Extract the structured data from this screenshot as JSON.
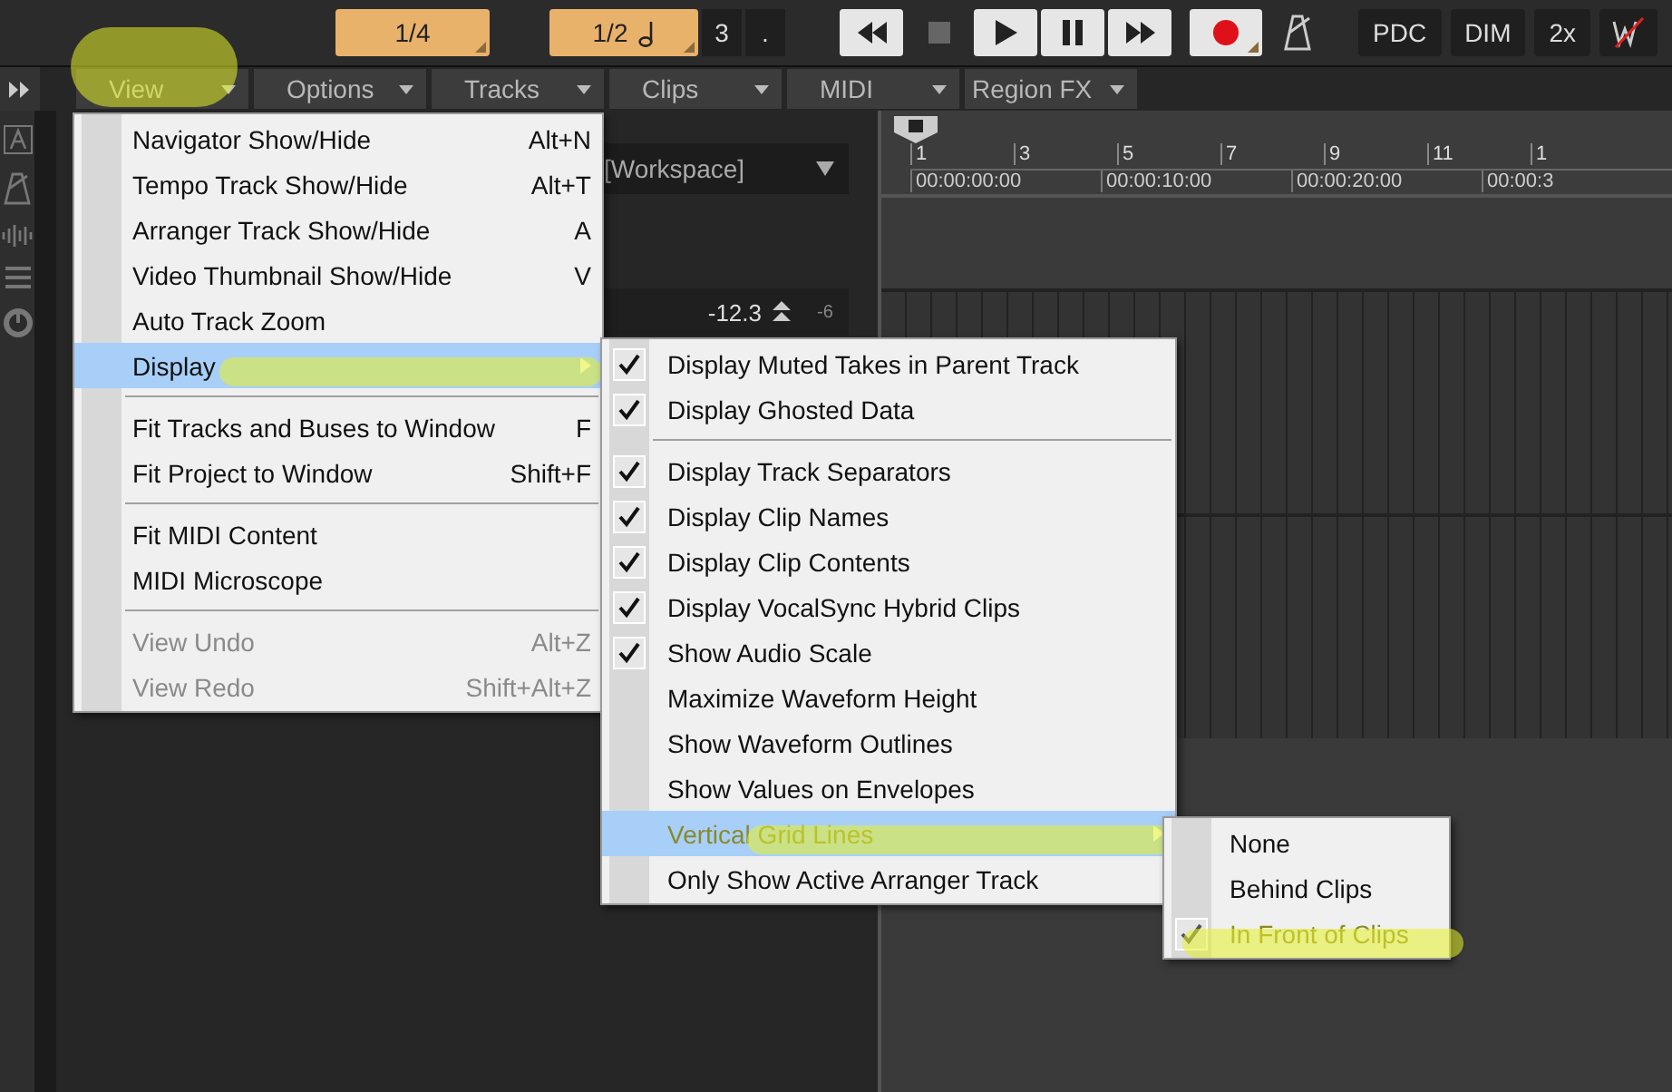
{
  "toolbar": {
    "snap": "1/4",
    "grid": "1/2",
    "triplet": "3",
    "dot": ".",
    "transport": [
      {
        "kind": "rewind"
      },
      {
        "kind": "stop"
      },
      {
        "kind": "play"
      },
      {
        "kind": "pause"
      },
      {
        "kind": "forward"
      }
    ],
    "record": {
      "kind": "record"
    },
    "metronome": {
      "kind": "metronome"
    },
    "right_buttons": [
      "PDC",
      "DIM",
      "2x"
    ]
  },
  "menu_bar": [
    {
      "label": "View",
      "highlighted": true
    },
    {
      "label": "Options",
      "highlighted": false
    },
    {
      "label": "Tracks",
      "highlighted": false
    },
    {
      "label": "Clips",
      "highlighted": false
    },
    {
      "label": "MIDI",
      "highlighted": false
    },
    {
      "label": "Region FX",
      "highlighted": false
    }
  ],
  "workspace": "[Workspace]",
  "track": {
    "volume": "-12.3",
    "meter_label": "-6"
  },
  "ruler": {
    "bars": [
      "1",
      "3",
      "5",
      "7",
      "9",
      "11",
      "1"
    ],
    "times": [
      "00:00:00:00",
      "00:00:10:00",
      "00:00:20:00",
      "00:00:3"
    ]
  },
  "view_menu": [
    [
      {
        "label": "Navigator Show/Hide",
        "shortcut": "Alt+N",
        "disabled": false,
        "selected": false,
        "submenu": false,
        "highlighted": false
      },
      {
        "label": "Tempo Track Show/Hide",
        "shortcut": "Alt+T",
        "disabled": false,
        "selected": false,
        "submenu": false,
        "highlighted": false
      },
      {
        "label": "Arranger Track Show/Hide",
        "shortcut": "A",
        "disabled": false,
        "selected": false,
        "submenu": false,
        "highlighted": false
      },
      {
        "label": "Video Thumbnail Show/Hide",
        "shortcut": "V",
        "disabled": false,
        "selected": false,
        "submenu": false,
        "highlighted": false
      },
      {
        "label": "Auto Track Zoom",
        "disabled": false,
        "selected": false,
        "submenu": false,
        "highlighted": false
      },
      {
        "label": "Display",
        "disabled": false,
        "selected": true,
        "submenu": true,
        "highlighted": true
      }
    ],
    [
      {
        "label": "Fit Tracks and Buses to Window",
        "shortcut": "F",
        "disabled": false,
        "selected": false,
        "submenu": false,
        "highlighted": false
      },
      {
        "label": "Fit Project to Window",
        "shortcut": "Shift+F",
        "disabled": false,
        "selected": false,
        "submenu": false,
        "highlighted": false
      }
    ],
    [
      {
        "label": "Fit MIDI Content",
        "disabled": false,
        "selected": false,
        "submenu": false,
        "highlighted": false
      },
      {
        "label": "MIDI Microscope",
        "disabled": false,
        "selected": false,
        "submenu": false,
        "highlighted": false
      }
    ],
    [
      {
        "label": "View Undo",
        "shortcut": "Alt+Z",
        "disabled": true,
        "selected": false,
        "submenu": false,
        "highlighted": false
      },
      {
        "label": "View Redo",
        "shortcut": "Shift+Alt+Z",
        "disabled": true,
        "selected": false,
        "submenu": false,
        "highlighted": false
      }
    ]
  ],
  "display_menu": [
    [
      {
        "label": "Display Muted Takes in Parent Track",
        "checked": true,
        "selected": false,
        "submenu": false,
        "highlighted": false
      },
      {
        "label": "Display Ghosted Data",
        "checked": true,
        "selected": false,
        "submenu": false,
        "highlighted": false
      }
    ],
    [
      {
        "label": "Display Track Separators",
        "checked": true,
        "selected": false,
        "submenu": false,
        "highlighted": false
      },
      {
        "label": "Display Clip Names",
        "checked": true,
        "selected": false,
        "submenu": false,
        "highlighted": false
      },
      {
        "label": "Display Clip Contents",
        "checked": true,
        "selected": false,
        "submenu": false,
        "highlighted": false
      },
      {
        "label": "Display VocalSync Hybrid Clips",
        "checked": true,
        "selected": false,
        "submenu": false,
        "highlighted": false
      },
      {
        "label": "Show Audio Scale",
        "checked": true,
        "selected": false,
        "submenu": false,
        "highlighted": false
      },
      {
        "label": "Maximize Waveform Height",
        "checked": false,
        "selected": false,
        "submenu": false,
        "highlighted": false
      },
      {
        "label": "Show Waveform Outlines",
        "checked": false,
        "selected": false,
        "submenu": false,
        "highlighted": false
      },
      {
        "label": "Show Values on Envelopes",
        "checked": false,
        "selected": false,
        "submenu": false,
        "highlighted": false
      },
      {
        "label": "Vertical Grid Lines",
        "checked": false,
        "selected": true,
        "submenu": true,
        "highlighted": true
      },
      {
        "label": "Only Show Active Arranger Track",
        "checked": false,
        "selected": false,
        "submenu": false,
        "highlighted": false
      }
    ]
  ],
  "grid_menu": [
    {
      "label": "None",
      "checked": false,
      "highlighted": false
    },
    {
      "label": "Behind Clips",
      "checked": false,
      "highlighted": false
    },
    {
      "label": "In Front of Clips",
      "checked": true,
      "highlighted": true
    }
  ]
}
